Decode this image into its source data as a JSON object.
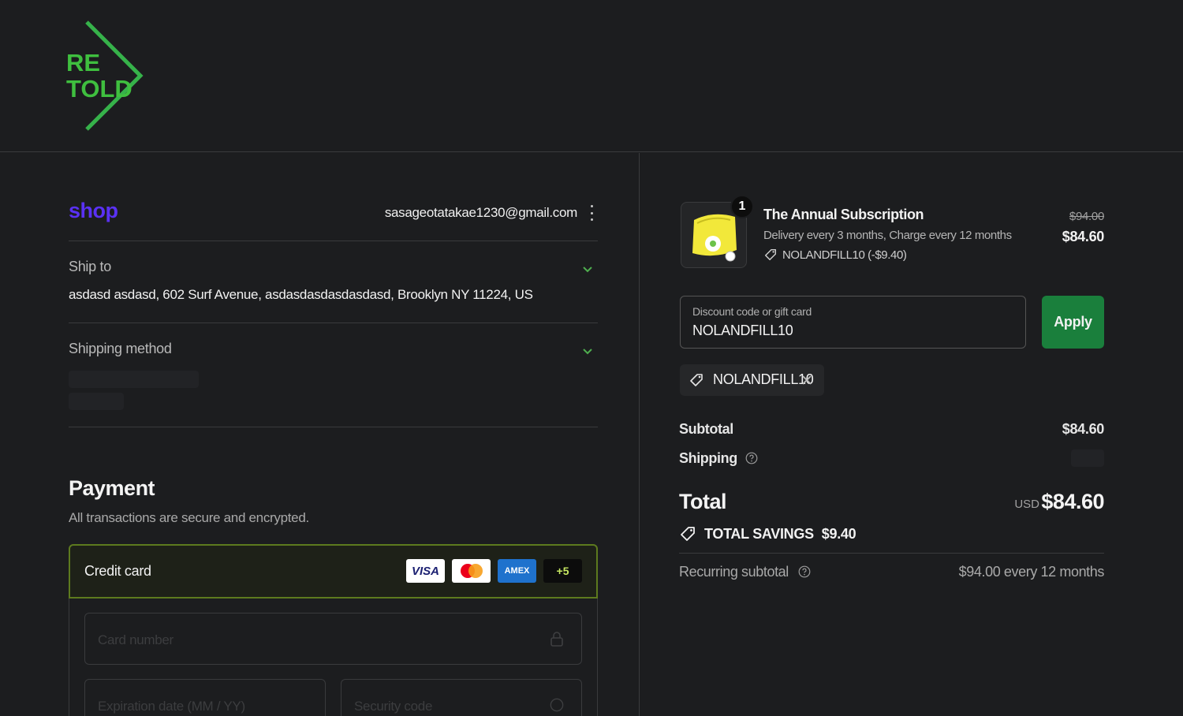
{
  "brand": {
    "logo_text_line1": "RE",
    "logo_text_line2": "TOLD",
    "logo_color": "#3fbf3f"
  },
  "express": {
    "shop_label": "shop",
    "email": "sasageotatakae1230@gmail.com",
    "shop_color": "#5a31f4"
  },
  "ship_to": {
    "label": "Ship to",
    "address": "asdasd asdasd, 602 Surf Avenue, asdasdasdasdasdasd, Brooklyn NY 11224, US"
  },
  "shipping_method": {
    "label": "Shipping method"
  },
  "payment": {
    "title": "Payment",
    "subtitle": "All transactions are secure and encrypted.",
    "method_label": "Credit card",
    "card_brands": [
      "VISA",
      "Mastercard",
      "AMEX",
      "+5"
    ],
    "card_number_placeholder": "Card number",
    "expiry_placeholder": "Expiration date (MM / YY)",
    "security_placeholder": "Security code"
  },
  "order": {
    "quantity": "1",
    "product_name": "The Annual Subscription",
    "product_desc": "Delivery every 3 months, Charge every 12 months",
    "product_discount": "NOLANDFILL10 (-$9.40)",
    "price_original": "$94.00",
    "price_current": "$84.60"
  },
  "discount": {
    "placeholder": "Discount code or gift card",
    "value": "NOLANDFILL10",
    "apply_label": "Apply",
    "applied_code": "NOLANDFILL10"
  },
  "summary": {
    "subtotal_label": "Subtotal",
    "subtotal_value": "$84.60",
    "shipping_label": "Shipping",
    "total_label": "Total",
    "currency": "USD",
    "total_value": "$84.60",
    "savings_label": "TOTAL SAVINGS",
    "savings_value": "$9.40",
    "recurring_label": "Recurring subtotal",
    "recurring_value": "$94.00 every 12 months"
  },
  "colors": {
    "background": "#1c1d1f",
    "apply_button": "#1a7f3c",
    "selected_border": "#5d7a1e"
  },
  "icons": [
    "kebab-menu-icon",
    "chevron-down-icon",
    "lock-icon",
    "question-icon",
    "tag-icon",
    "close-icon"
  ]
}
